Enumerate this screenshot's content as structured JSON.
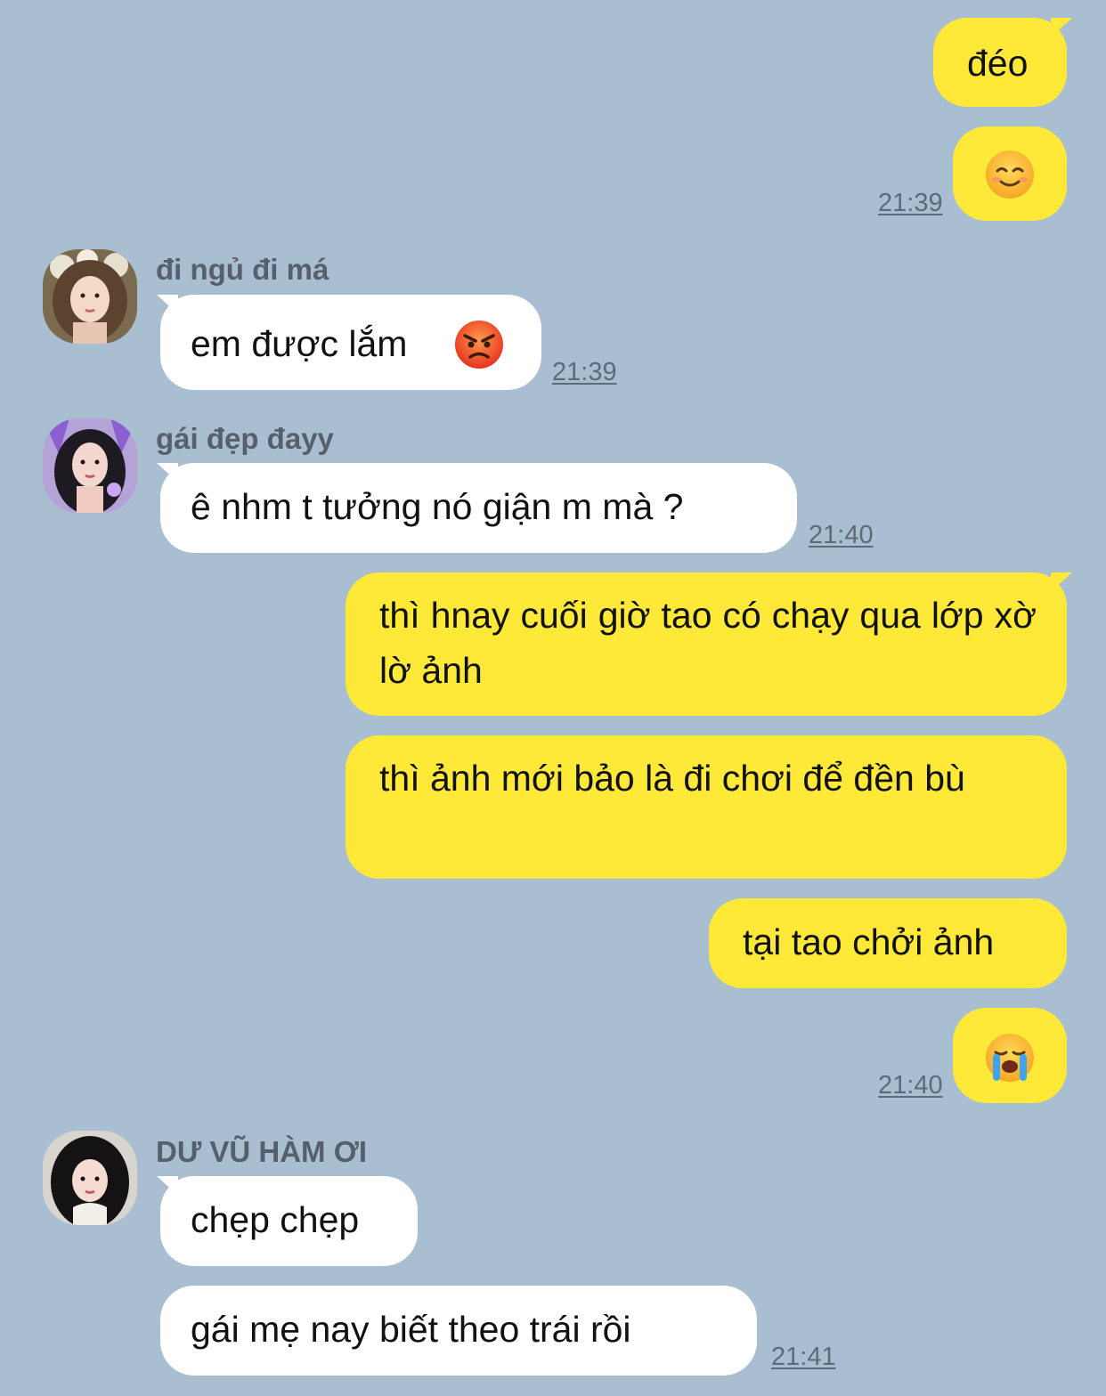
{
  "messages": [
    {
      "text": "đéo"
    },
    {
      "emoji": "smiling-face-icon",
      "time": "21:39"
    },
    {
      "sender": "đi ngủ đi má",
      "text": "em được lắm",
      "emoji": "angry-face-icon",
      "time": "21:39"
    },
    {
      "sender": "gái đẹp đayy",
      "text": "ê nhm t tưởng nó giận m mà ?",
      "time": "21:40"
    },
    {
      "text": "thì hnay cuối giờ tao có chạy qua lớp xờ lờ ảnh"
    },
    {
      "text": "thì ảnh mới bảo là đi chơi để đền bù"
    },
    {
      "text": "tại tao chởi ảnh"
    },
    {
      "emoji": "loudly-crying-face-icon",
      "time": "21:40"
    },
    {
      "sender": "DƯ VŨ HÀM ƠI",
      "text": "chẹp chẹp"
    },
    {
      "text": "gái mẹ nay biết theo trái rồi",
      "time": "21:41"
    }
  ],
  "colors": {
    "background": "#a9bed1",
    "my_bubble": "#fee938",
    "their_bubble": "#ffffff",
    "timestamp": "#5d6a78",
    "sender_name": "#56606d"
  }
}
